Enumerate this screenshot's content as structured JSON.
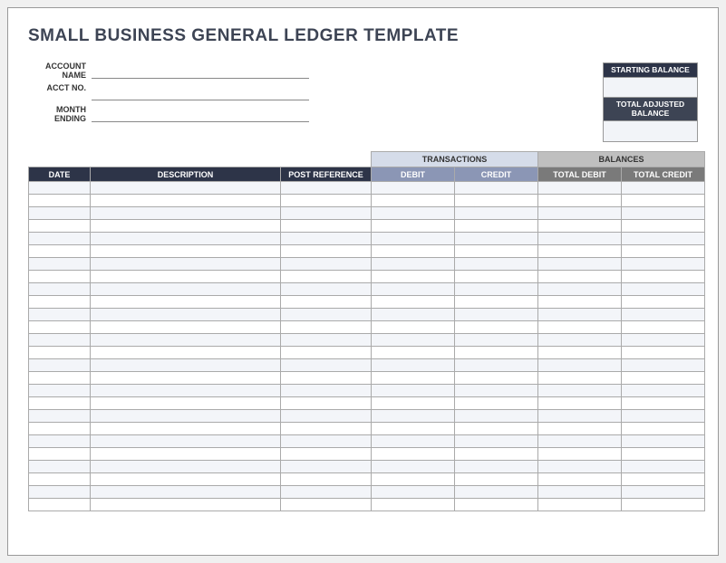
{
  "title": "SMALL BUSINESS GENERAL LEDGER TEMPLATE",
  "fields": {
    "account_name_label": "ACCOUNT NAME",
    "account_name_value": "",
    "acct_no_label": "ACCT NO.",
    "acct_no_value": "",
    "month_ending_label": "MONTH ENDING",
    "month_ending_value": ""
  },
  "balances_box": {
    "starting_balance_label": "STARTING BALANCE",
    "starting_balance_value": "",
    "total_adjusted_label": "TOTAL ADJUSTED BALANCE",
    "total_adjusted_value": ""
  },
  "group_headers": {
    "transactions": "TRANSACTIONS",
    "balances": "BALANCES"
  },
  "columns": {
    "date": "DATE",
    "description": "DESCRIPTION",
    "post_reference": "POST REFERENCE",
    "debit": "DEBIT",
    "credit": "CREDIT",
    "total_debit": "TOTAL DEBIT",
    "total_credit": "TOTAL CREDIT"
  },
  "rows": [
    {
      "date": "",
      "description": "",
      "post_reference": "",
      "debit": "",
      "credit": "",
      "total_debit": "",
      "total_credit": ""
    },
    {
      "date": "",
      "description": "",
      "post_reference": "",
      "debit": "",
      "credit": "",
      "total_debit": "",
      "total_credit": ""
    },
    {
      "date": "",
      "description": "",
      "post_reference": "",
      "debit": "",
      "credit": "",
      "total_debit": "",
      "total_credit": ""
    },
    {
      "date": "",
      "description": "",
      "post_reference": "",
      "debit": "",
      "credit": "",
      "total_debit": "",
      "total_credit": ""
    },
    {
      "date": "",
      "description": "",
      "post_reference": "",
      "debit": "",
      "credit": "",
      "total_debit": "",
      "total_credit": ""
    },
    {
      "date": "",
      "description": "",
      "post_reference": "",
      "debit": "",
      "credit": "",
      "total_debit": "",
      "total_credit": ""
    },
    {
      "date": "",
      "description": "",
      "post_reference": "",
      "debit": "",
      "credit": "",
      "total_debit": "",
      "total_credit": ""
    },
    {
      "date": "",
      "description": "",
      "post_reference": "",
      "debit": "",
      "credit": "",
      "total_debit": "",
      "total_credit": ""
    },
    {
      "date": "",
      "description": "",
      "post_reference": "",
      "debit": "",
      "credit": "",
      "total_debit": "",
      "total_credit": ""
    },
    {
      "date": "",
      "description": "",
      "post_reference": "",
      "debit": "",
      "credit": "",
      "total_debit": "",
      "total_credit": ""
    },
    {
      "date": "",
      "description": "",
      "post_reference": "",
      "debit": "",
      "credit": "",
      "total_debit": "",
      "total_credit": ""
    },
    {
      "date": "",
      "description": "",
      "post_reference": "",
      "debit": "",
      "credit": "",
      "total_debit": "",
      "total_credit": ""
    },
    {
      "date": "",
      "description": "",
      "post_reference": "",
      "debit": "",
      "credit": "",
      "total_debit": "",
      "total_credit": ""
    },
    {
      "date": "",
      "description": "",
      "post_reference": "",
      "debit": "",
      "credit": "",
      "total_debit": "",
      "total_credit": ""
    },
    {
      "date": "",
      "description": "",
      "post_reference": "",
      "debit": "",
      "credit": "",
      "total_debit": "",
      "total_credit": ""
    },
    {
      "date": "",
      "description": "",
      "post_reference": "",
      "debit": "",
      "credit": "",
      "total_debit": "",
      "total_credit": ""
    },
    {
      "date": "",
      "description": "",
      "post_reference": "",
      "debit": "",
      "credit": "",
      "total_debit": "",
      "total_credit": ""
    },
    {
      "date": "",
      "description": "",
      "post_reference": "",
      "debit": "",
      "credit": "",
      "total_debit": "",
      "total_credit": ""
    },
    {
      "date": "",
      "description": "",
      "post_reference": "",
      "debit": "",
      "credit": "",
      "total_debit": "",
      "total_credit": ""
    },
    {
      "date": "",
      "description": "",
      "post_reference": "",
      "debit": "",
      "credit": "",
      "total_debit": "",
      "total_credit": ""
    },
    {
      "date": "",
      "description": "",
      "post_reference": "",
      "debit": "",
      "credit": "",
      "total_debit": "",
      "total_credit": ""
    },
    {
      "date": "",
      "description": "",
      "post_reference": "",
      "debit": "",
      "credit": "",
      "total_debit": "",
      "total_credit": ""
    },
    {
      "date": "",
      "description": "",
      "post_reference": "",
      "debit": "",
      "credit": "",
      "total_debit": "",
      "total_credit": ""
    },
    {
      "date": "",
      "description": "",
      "post_reference": "",
      "debit": "",
      "credit": "",
      "total_debit": "",
      "total_credit": ""
    },
    {
      "date": "",
      "description": "",
      "post_reference": "",
      "debit": "",
      "credit": "",
      "total_debit": "",
      "total_credit": ""
    },
    {
      "date": "",
      "description": "",
      "post_reference": "",
      "debit": "",
      "credit": "",
      "total_debit": "",
      "total_credit": ""
    }
  ]
}
